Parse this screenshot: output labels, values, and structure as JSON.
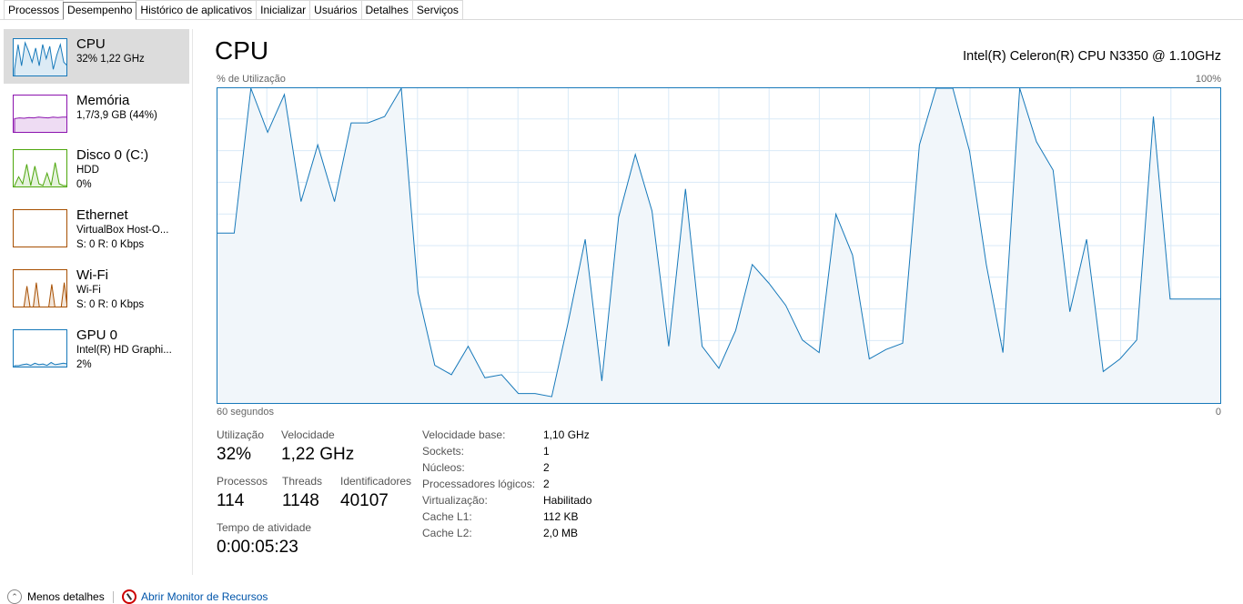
{
  "tabs": [
    "Processos",
    "Desempenho",
    "Histórico de aplicativos",
    "Inicializar",
    "Usuários",
    "Detalhes",
    "Serviços"
  ],
  "sidebar": [
    {
      "title": "CPU",
      "line2": "32%  1,22 GHz",
      "line3": "",
      "color": "#1779ba"
    },
    {
      "title": "Memória",
      "line2": "1,7/3,9 GB (44%)",
      "line3": "",
      "color": "#8b12ae"
    },
    {
      "title": "Disco 0 (C:)",
      "line2": "HDD",
      "line3": "0%",
      "color": "#4da60c"
    },
    {
      "title": "Ethernet",
      "line2": "VirtualBox Host-O...",
      "line3": "S: 0  R: 0 Kbps",
      "color": "#a74f01"
    },
    {
      "title": "Wi-Fi",
      "line2": "Wi-Fi",
      "line3": "S: 0  R: 0 Kbps",
      "color": "#a74f01"
    },
    {
      "title": "GPU 0",
      "line2": "Intel(R) HD Graphi...",
      "line3": "2%",
      "color": "#1779ba"
    }
  ],
  "main": {
    "title": "CPU",
    "model": "Intel(R) Celeron(R) CPU N3350 @ 1.10GHz",
    "axis_label": "% de Utilização",
    "axis_max": "100%",
    "axis_time": "60 segundos",
    "axis_zero": "0"
  },
  "stats": {
    "util_label": "Utilização",
    "util_value": "32%",
    "speed_label": "Velocidade",
    "speed_value": "1,22 GHz",
    "proc_label": "Processos",
    "proc_value": "114",
    "threads_label": "Threads",
    "threads_value": "1148",
    "handles_label": "Identificadores",
    "handles_value": "40107",
    "uptime_label": "Tempo de atividade",
    "uptime_value": "0:00:05:23"
  },
  "info": [
    {
      "label": "Velocidade base:",
      "value": "1,10 GHz"
    },
    {
      "label": "Sockets:",
      "value": "1"
    },
    {
      "label": "Núcleos:",
      "value": "2"
    },
    {
      "label": "Processadores lógicos:",
      "value": "2"
    },
    {
      "label": "Virtualização:",
      "value": "Habilitado"
    },
    {
      "label": "Cache L1:",
      "value": "112 KB"
    },
    {
      "label": "Cache L2:",
      "value": "2,0 MB"
    }
  ],
  "footer": {
    "fewer_details": "Menos detalhes",
    "resource_monitor": "Abrir Monitor de Recursos"
  },
  "chart_data": {
    "type": "area",
    "xlabel": "60 segundos",
    "ylabel": "% de Utilização",
    "ylim": [
      0,
      100
    ],
    "xlim": [
      60,
      0
    ],
    "x": [
      60,
      59,
      58,
      57,
      56,
      55,
      54,
      53,
      52,
      51,
      50,
      49,
      48,
      47,
      46,
      45,
      44,
      43,
      42,
      41,
      40,
      39,
      38,
      37,
      36,
      35,
      34,
      33,
      32,
      31,
      30,
      29,
      28,
      27,
      26,
      25,
      24,
      23,
      22,
      21,
      20,
      19,
      18,
      17,
      16,
      15,
      14,
      13,
      12,
      11,
      10,
      9,
      8,
      7,
      6,
      5,
      4,
      3,
      2,
      1,
      0
    ],
    "values": [
      54,
      54,
      100,
      86,
      98,
      64,
      82,
      64,
      89,
      89,
      91,
      100,
      35,
      12,
      9,
      18,
      8,
      9,
      3,
      3,
      2,
      26,
      52,
      7,
      59,
      79,
      61,
      18,
      68,
      18,
      11,
      23,
      44,
      38,
      31,
      20,
      16,
      60,
      47,
      14,
      17,
      19,
      82,
      100,
      100,
      80,
      44,
      16,
      100,
      83,
      74,
      29,
      52,
      10,
      14,
      20,
      91,
      33,
      33,
      33,
      33
    ]
  }
}
